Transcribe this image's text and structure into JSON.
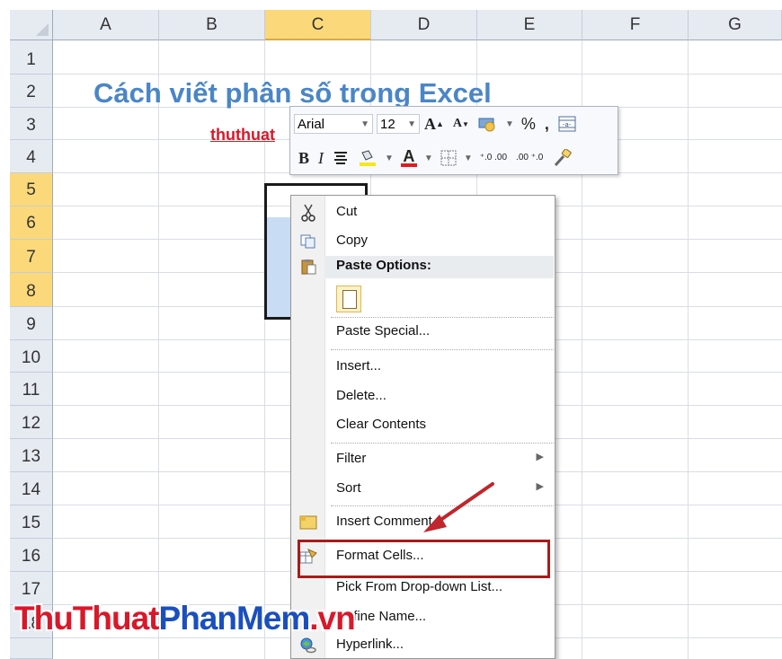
{
  "columns": [
    "A",
    "B",
    "C",
    "D",
    "E",
    "F",
    "G"
  ],
  "selected_column": "C",
  "rows": [
    "1",
    "2",
    "3",
    "4",
    "5",
    "6",
    "7",
    "8",
    "9",
    "10",
    "11",
    "12",
    "13",
    "14",
    "15",
    "16",
    "17",
    "18"
  ],
  "selected_rows": [
    "5",
    "6",
    "7",
    "8"
  ],
  "sheet": {
    "title": "Cách viết phân số trong Excel",
    "subtitle": "thuthuat"
  },
  "mini_toolbar": {
    "font_name": "Arial",
    "font_size": "12",
    "grow_font": "A",
    "shrink_font": "A",
    "percent": "%",
    "comma": ",",
    "bold": "B",
    "italic": "I",
    "font_color": "A",
    "inc_decimal": "⁺.0 .00",
    "dec_decimal": ".00 ⁺.0"
  },
  "context_menu": {
    "cut": "Cut",
    "copy": "Copy",
    "paste_options": "Paste Options:",
    "paste_special": "Paste Special...",
    "insert": "Insert...",
    "delete": "Delete...",
    "clear_contents": "Clear Contents",
    "filter": "Filter",
    "sort": "Sort",
    "insert_comment": "Insert Comment",
    "format_cells": "Format Cells...",
    "pick_list": "Pick From Drop-down List...",
    "define_name": "Define Name...",
    "hyperlink": "Hyperlink..."
  },
  "watermark": {
    "part1": "ThuThuat",
    "part2": "PhanMem",
    "part3": ".vn"
  },
  "colors": {
    "header_bg": "#e6ebf2",
    "selected_header": "#fbd97a",
    "title": "#4a86c6",
    "subtitle": "#d9182a",
    "highlight_box": "#a91b1b"
  }
}
